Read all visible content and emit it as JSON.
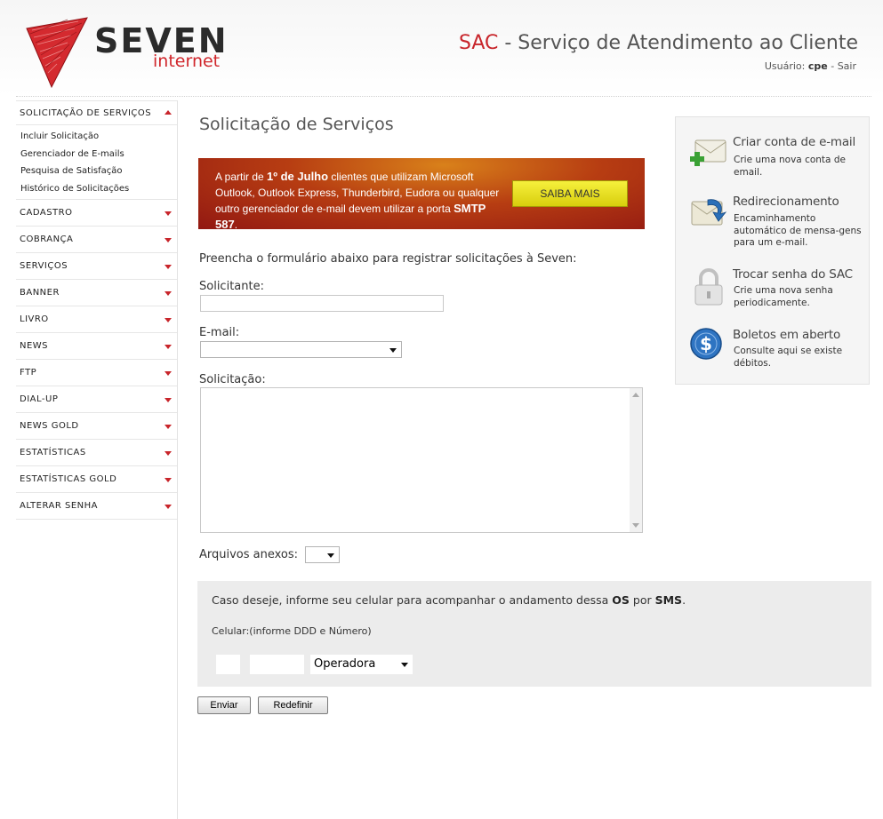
{
  "header": {
    "logo_word": "SEVEN",
    "logo_sub": "internet",
    "title_sac": "SAC",
    "title_rest": " - Serviço de Atendimento ao Cliente",
    "user_label": "Usuário:",
    "user_name": "cpe",
    "separator": "-",
    "logout": "Sair"
  },
  "sidebar": {
    "open_section": "SOLICITAÇÃO DE SERVIÇOS",
    "sub_items": [
      "Incluir Solicitação",
      "Gerenciador de E-mails",
      "Pesquisa de Satisfação",
      "Histórico de Solicitações"
    ],
    "sections": [
      "CADASTRO",
      "COBRANÇA",
      "SERVIÇOS",
      "BANNER",
      "LIVRO",
      "NEWS",
      "FTP",
      "DIAL-UP",
      "NEWS GOLD",
      "ESTATÍSTICAS",
      "ESTATÍSTICAS GOLD",
      "ALTERAR SENHA"
    ]
  },
  "main": {
    "page_title": "Solicitação de Serviços",
    "banner": {
      "t1": "A partir de ",
      "b1": "1º de Julho",
      "t2": " clientes que utilizam Microsoft Outlook, Outlook Express, Thunderbird, Eudora ou qualquer outro gerenciador de e-mail devem utilizar a porta ",
      "b2": "SMTP 587",
      "t3": ".",
      "button": "SAIBA MAIS"
    },
    "intro": "Preencha o formulário abaixo para registrar solicitações à Seven:",
    "solicitante_label": "Solicitante:",
    "solicitante_value": "",
    "email_label": "E-mail:",
    "email_value": "",
    "solicitacao_label": "Solicitação:",
    "solicitacao_value": "",
    "anexos_label": "Arquivos anexos:",
    "anexos_value": "",
    "sms": {
      "t1": "Caso deseje, informe seu celular para acompanhar o andamento dessa ",
      "b1": "OS",
      "t2": " por ",
      "b2": "SMS",
      "t3": ".",
      "celular_label": "Celular:(informe DDD e Número)",
      "ddd_value": "",
      "numero_value": "",
      "operadora": "Operadora"
    },
    "submit": "Enviar",
    "reset": "Redefinir"
  },
  "right_panel": [
    {
      "title": "Criar conta de e-mail",
      "desc": "Crie uma nova conta de email.",
      "icon": "new-mail-icon"
    },
    {
      "title": "Redirecionamento",
      "desc": "Encaminhamento automático de mensa-gens para um e-mail.",
      "icon": "forward-mail-icon"
    },
    {
      "title": "Trocar senha do SAC",
      "desc": "Crie uma nova senha periodicamente.",
      "icon": "lock-icon"
    },
    {
      "title": "Boletos em aberto",
      "desc": "Consulte aqui se existe débitos.",
      "icon": "dollar-icon"
    }
  ],
  "colors": {
    "brand_red": "#c8252b",
    "banner_dark": "#921812",
    "banner_button": "#e9e021",
    "panel_bg": "#f5f5f5"
  }
}
